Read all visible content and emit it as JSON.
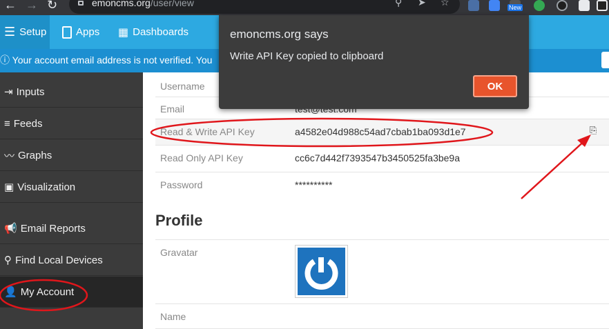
{
  "browser": {
    "url_host": "emoncms.org",
    "url_path": "/user/view",
    "ext_badge": "New"
  },
  "topnav": {
    "setup": "Setup",
    "apps": "Apps",
    "dashboards": "Dashboards"
  },
  "alert": {
    "message": "Your account email address is not verified. You"
  },
  "sidebar": {
    "items": [
      {
        "label": "Inputs"
      },
      {
        "label": "Feeds"
      },
      {
        "label": "Graphs"
      },
      {
        "label": "Visualization"
      },
      {
        "label": "Email Reports"
      },
      {
        "label": "Find Local Devices"
      },
      {
        "label": "My Account"
      }
    ]
  },
  "account": {
    "username_label": "Username",
    "email_label": "Email",
    "email_value": "test@test.com",
    "rw_key_label": "Read & Write API Key",
    "rw_key_value": "a4582e04d988c54ad7cbab1ba093d1e7",
    "ro_key_label": "Read Only API Key",
    "ro_key_value": "cc6c7d442f7393547b3450525fa3be9a",
    "password_label": "Password",
    "password_value": "**********"
  },
  "profile": {
    "heading": "Profile",
    "gravatar_label": "Gravatar",
    "name_label": "Name"
  },
  "dialog": {
    "title": "emoncms.org says",
    "message": "Write API Key copied to clipboard",
    "ok_label": "OK"
  },
  "colors": {
    "accent": "#2da9e1",
    "ok_button": "#e8542c",
    "annotation": "#e0161b"
  }
}
